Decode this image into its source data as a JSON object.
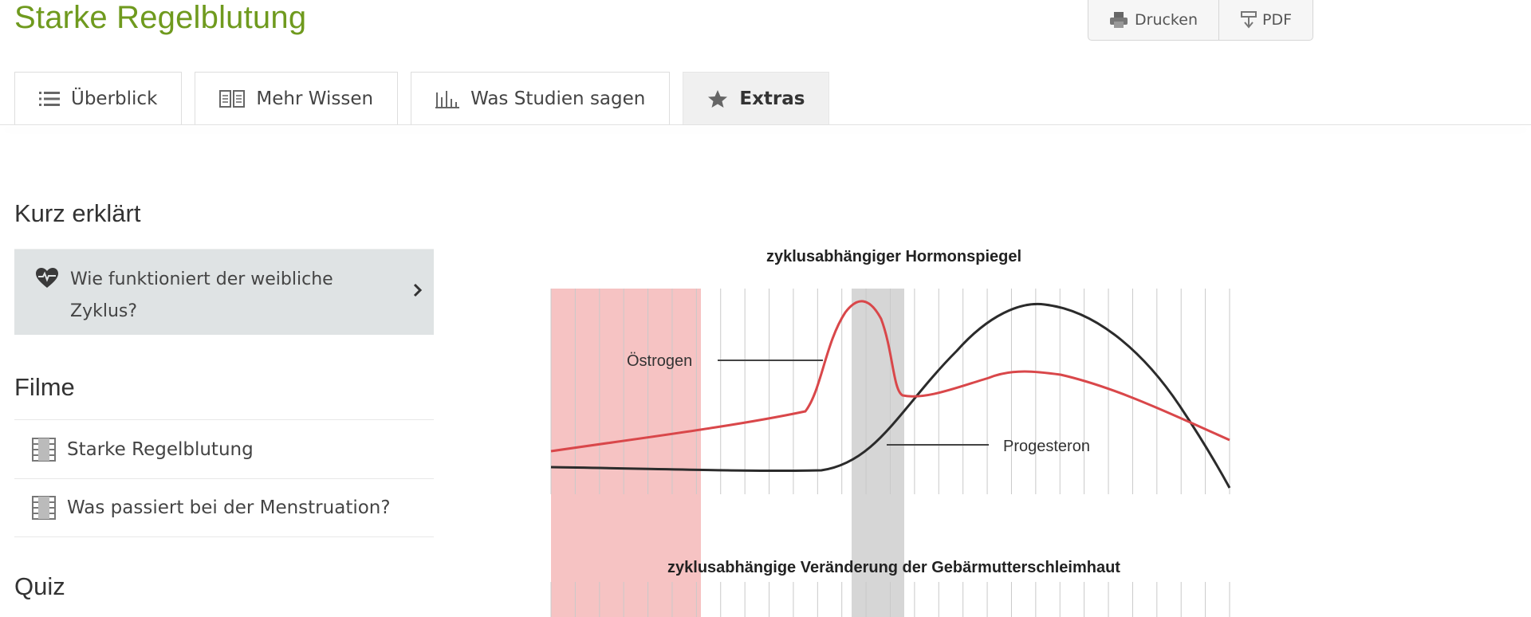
{
  "page": {
    "title": "Starke Regelblutung"
  },
  "actions": {
    "print": "Drucken",
    "pdf": "PDF"
  },
  "tabs": [
    {
      "label": "Überblick",
      "icon": "list-icon"
    },
    {
      "label": "Mehr Wissen",
      "icon": "book-icon"
    },
    {
      "label": "Was Studien sagen",
      "icon": "bar-chart-icon"
    },
    {
      "label": "Extras",
      "icon": "star-icon",
      "active": true
    }
  ],
  "sidebar": {
    "sections": [
      {
        "title": "Kurz erklärt",
        "items": [
          {
            "label": "Wie funktioniert der weibliche Zyklus?",
            "icon": "heart-pulse-icon"
          }
        ]
      },
      {
        "title": "Filme",
        "items": [
          {
            "label": "Starke Regelblutung",
            "icon": "film-icon"
          },
          {
            "label": "Was passiert bei der Menstruation?",
            "icon": "film-icon"
          }
        ]
      },
      {
        "title": "Quiz",
        "items": []
      }
    ]
  },
  "diagram": {
    "title_top": "zyklusabhängiger Hormonspiegel",
    "label_estrogen": "Östrogen",
    "label_progesterone": "Progesteron",
    "title_bottom": "zyklusabhängige Veränderung der Gebärmutterschleimhaut",
    "colors": {
      "estrogen": "#d9474a",
      "progesterone": "#2b2b2b",
      "menstruation_band": "#f6c3c3",
      "ovulation_band": "#d6d6d6"
    }
  }
}
